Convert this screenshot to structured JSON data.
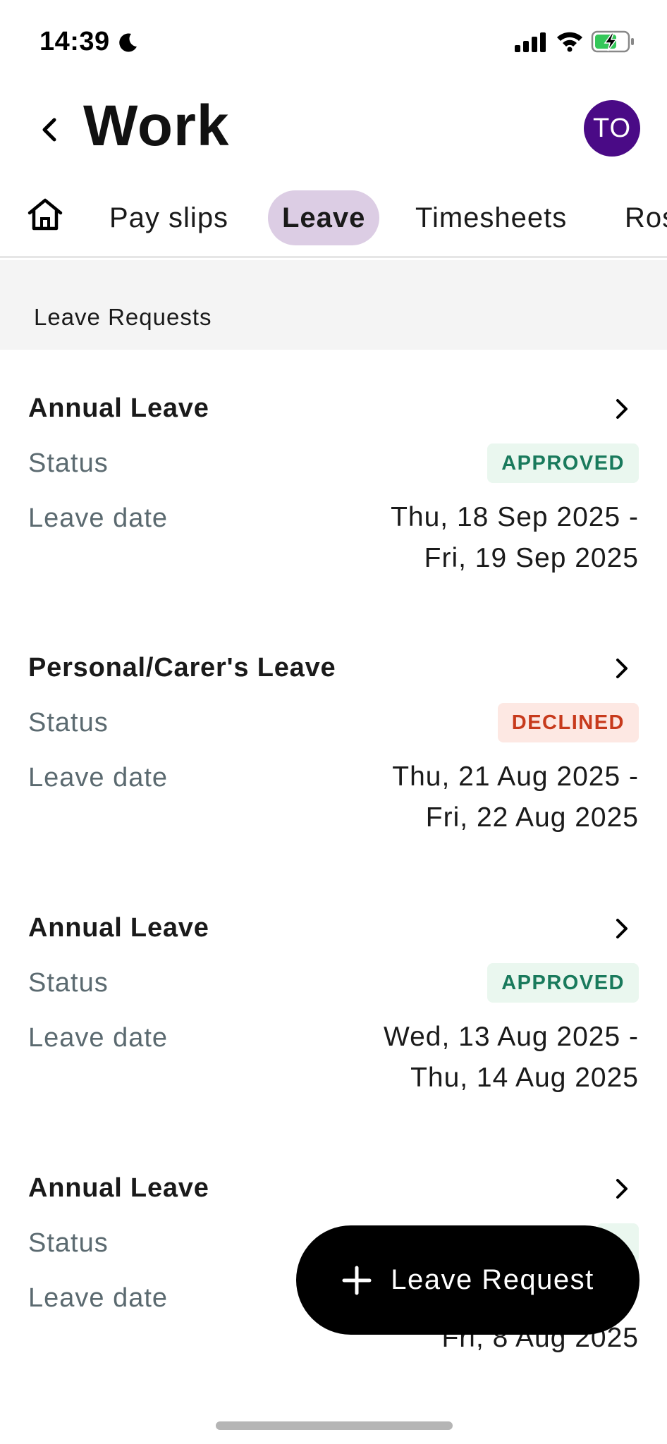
{
  "status_bar": {
    "time": "14:39"
  },
  "header": {
    "title": "Work",
    "avatar_initials": "TO"
  },
  "tabs": [
    {
      "label": "Pay slips",
      "active": false
    },
    {
      "label": "Leave",
      "active": true
    },
    {
      "label": "Timesheets",
      "active": false
    },
    {
      "label": "Ros",
      "active": false
    }
  ],
  "section": {
    "title": "Leave Requests"
  },
  "labels": {
    "status": "Status",
    "leave_date": "Leave date"
  },
  "requests": [
    {
      "type": "Annual Leave",
      "status": "APPROVED",
      "date_line1": "Thu, 18 Sep 2025 -",
      "date_line2": "Fri, 19 Sep 2025"
    },
    {
      "type": "Personal/Carer's Leave",
      "status": "DECLINED",
      "date_line1": "Thu, 21 Aug 2025 -",
      "date_line2": "Fri, 22 Aug 2025"
    },
    {
      "type": "Annual Leave",
      "status": "APPROVED",
      "date_line1": "Wed, 13 Aug 2025 -",
      "date_line2": "Thu, 14 Aug 2025"
    },
    {
      "type": "Annual Leave",
      "status": "",
      "date_line1": "",
      "date_line2": "Fri, 8 Aug 2025"
    }
  ],
  "fab": {
    "label": "Leave Request"
  },
  "colors": {
    "avatar": "#4a0a86",
    "active_tab": "#dccde4",
    "approved": "#197a5c",
    "declined": "#c73a1c"
  }
}
